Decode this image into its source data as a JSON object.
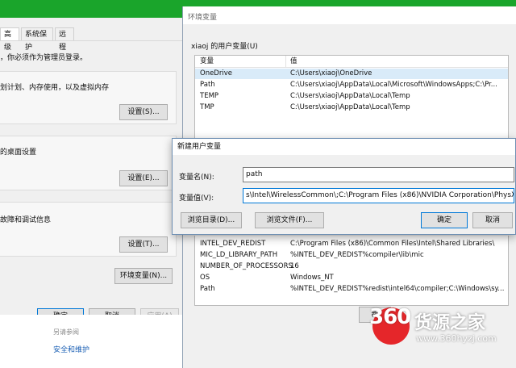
{
  "system_properties": {
    "tabs": [
      "高级",
      "系统保护",
      "远程"
    ],
    "admin_note": "，你必须作为管理员登录。",
    "performance_desc": "划计划、内存使用，以及虚拟内存",
    "settings_s": "设置(S)...",
    "profile_desc": "的桌面设置",
    "settings_e": "设置(E)...",
    "startup_desc": "故障和调试信息",
    "settings_t": "设置(T)...",
    "env_button": "环境变量(N)...",
    "ok": "确定",
    "cancel": "取消",
    "apply": "应用(A)",
    "see_also": "另请参阅",
    "security_link": "安全和维护"
  },
  "env_window": {
    "title": "环境变量",
    "user_section_label": "xiaoj 的用户变量(U)",
    "col_variable": "变量",
    "col_value": "值",
    "user_vars": [
      {
        "name": "OneDrive",
        "value": "C:\\Users\\xiaoj\\OneDrive"
      },
      {
        "name": "Path",
        "value": "C:\\Users\\xiaoj\\AppData\\Local\\Microsoft\\WindowsApps;C:\\Pr..."
      },
      {
        "name": "TEMP",
        "value": "C:\\Users\\xiaoj\\AppData\\Local\\Temp"
      },
      {
        "name": "TMP",
        "value": "C:\\Users\\xiaoj\\AppData\\Local\\Temp"
      }
    ],
    "system_vars": [
      {
        "name": "INTEL_DEV_REDIST",
        "value": "C:\\Program Files (x86)\\Common Files\\Intel\\Shared Libraries\\"
      },
      {
        "name": "MIC_LD_LIBRARY_PATH",
        "value": "%INTEL_DEV_REDIST%compiler\\lib\\mic"
      },
      {
        "name": "NUMBER_OF_PROCESSORS",
        "value": "16"
      },
      {
        "name": "OS",
        "value": "Windows_NT"
      },
      {
        "name": "Path",
        "value": "%INTEL_DEV_REDIST%redist\\intel64\\compiler;C:\\Windows\\sy..."
      }
    ],
    "new_button_partial": "新"
  },
  "new_var_dialog": {
    "title": "新建用户变量",
    "name_label": "变量名(N):",
    "name_value": "path",
    "value_label": "变量值(V):",
    "value_text": "s\\Intel\\WirelessCommon\\;C:\\Program Files (x86)\\NVIDIA Corporation\\PhysX\\Common",
    "browse_dir": "浏览目录(D)...",
    "browse_file": "浏览文件(F)...",
    "ok": "确定",
    "cancel": "取消"
  },
  "watermark": {
    "logo_number": "360",
    "brand": "货源之家",
    "url": "www.360hyzj.com"
  }
}
